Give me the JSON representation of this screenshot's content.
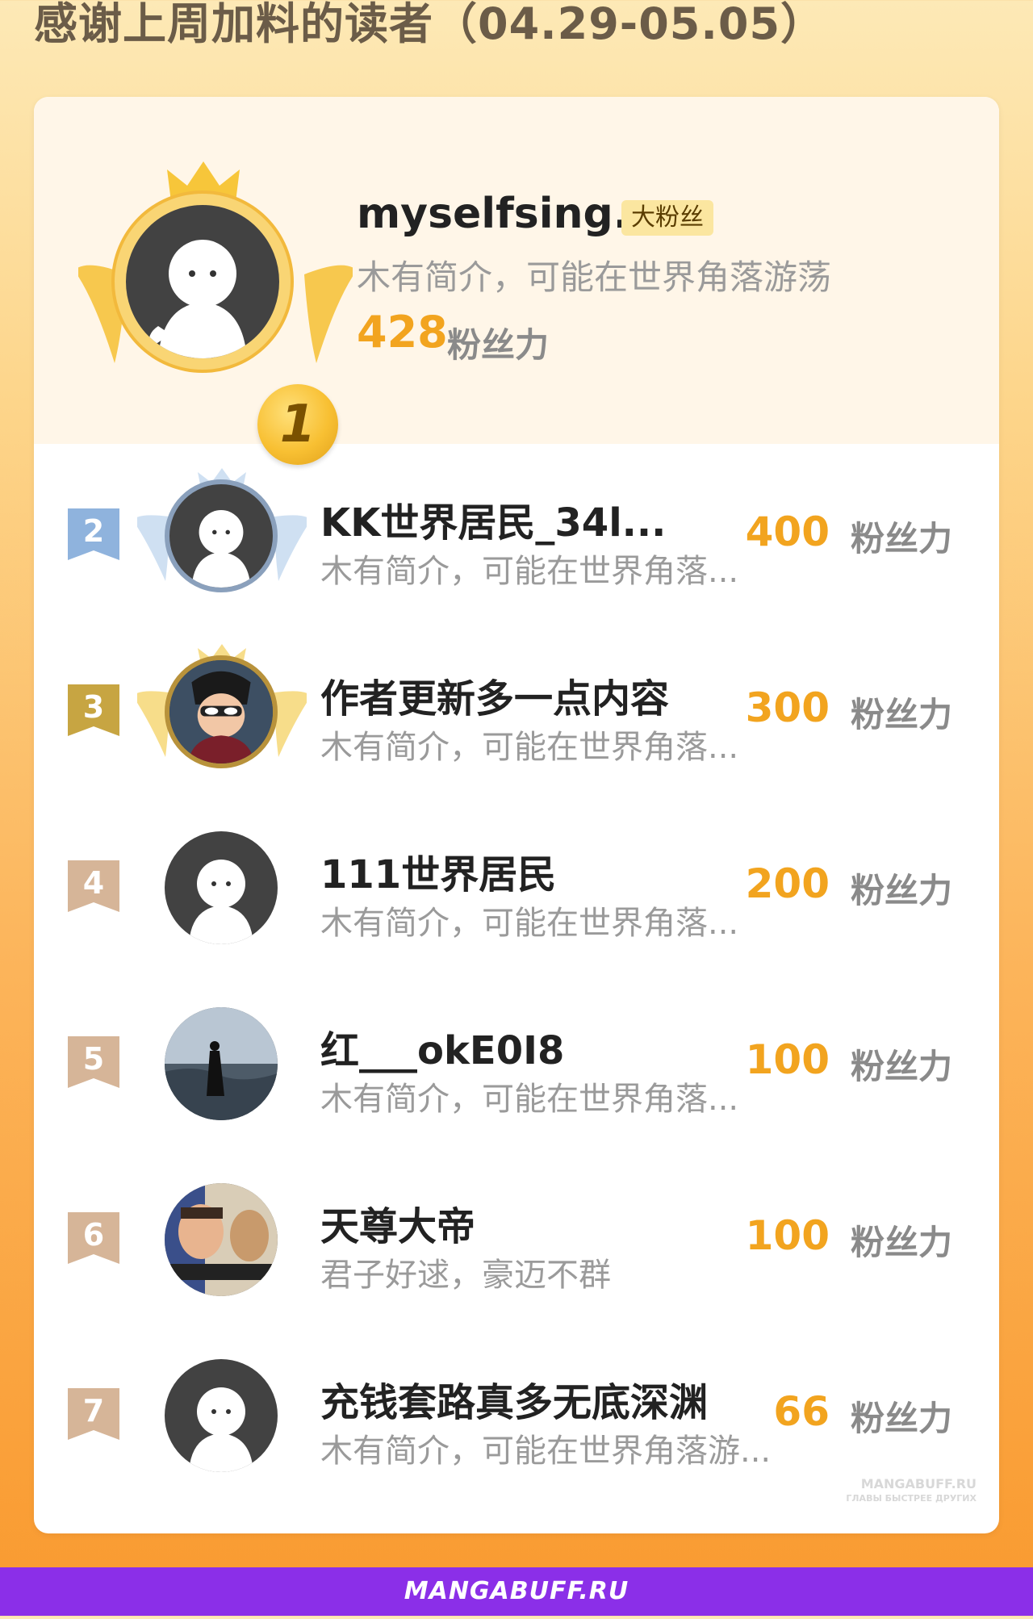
{
  "header": {
    "title": "感谢上周加料的读者（04.29-05.05）"
  },
  "top": {
    "rank": "1",
    "name": "myselfsing...",
    "badge": "大粉丝",
    "bio": "木有简介，可能在世界角落游荡",
    "score": "428",
    "unit": "粉丝力"
  },
  "rows": [
    {
      "rank": "2",
      "name": "KK世界居民_34l...",
      "bio": "木有简介，可能在世界角落...",
      "score": "400",
      "unit": "粉丝力",
      "avatar": "default-avatar",
      "ring": "silver"
    },
    {
      "rank": "3",
      "name": "作者更新多一点内容",
      "bio": "木有简介，可能在世界角落...",
      "score": "300",
      "unit": "粉丝力",
      "avatar": "cartoon-avatar",
      "ring": "gold"
    },
    {
      "rank": "4",
      "name": "111世界居民",
      "bio": "木有简介，可能在世界角落...",
      "score": "200",
      "unit": "粉丝力",
      "avatar": "default-avatar",
      "ring": "none"
    },
    {
      "rank": "5",
      "name": "红___okE0I8",
      "bio": "木有简介，可能在世界角落...",
      "score": "100",
      "unit": "粉丝力",
      "avatar": "photo-avatar",
      "ring": "none"
    },
    {
      "rank": "6",
      "name": "天尊大帝",
      "bio": "君子好逑，豪迈不群",
      "score": "100",
      "unit": "粉丝力",
      "avatar": "comic-avatar",
      "ring": "none"
    },
    {
      "rank": "7",
      "name": "充钱套路真多无底深渊",
      "bio": "木有简介，可能在世界角落游...",
      "score": "66",
      "unit": "粉丝力",
      "avatar": "default-avatar",
      "ring": "none"
    }
  ],
  "watermark": {
    "line1": "MANGABUFF.RU",
    "line2": "ГЛАВЫ БЫСТРЕЕ ДРУГИХ"
  },
  "footer": {
    "site": "MANGABUFF.RU"
  },
  "colors": {
    "score": "#f2a41f",
    "rank2_flag": "#8fb3dd",
    "rank3_flag": "#c7a542",
    "rank_flag_other": "#d6b598",
    "footer": "#8b2fe8"
  }
}
